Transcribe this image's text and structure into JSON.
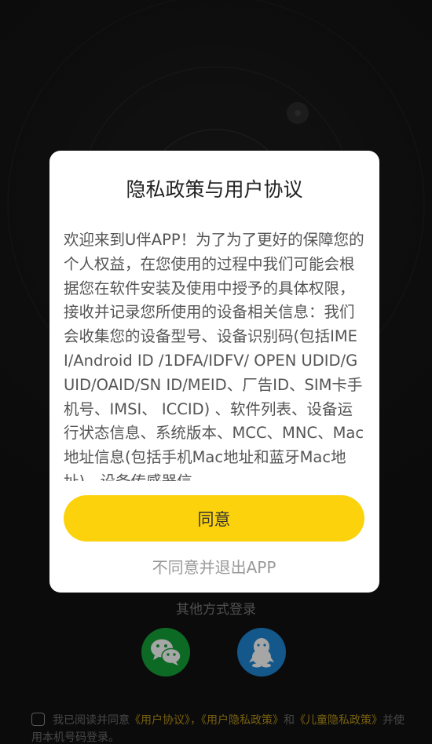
{
  "dialog": {
    "title": "隐私政策与用户协议",
    "body": "欢迎来到U伴APP！为了为了更好的保障您的个人权益，在您使用的过程中我们可能会根据您在软件安装及使用中授予的具体权限，接收并记录您所使用的设备相关信息：我们会收集您的设备型号、设备识别码(包括IMEI/Android ID /1DFA/IDFV/ OPEN UDID/GUID/OAID/SN ID/MEID、厂告ID、SIM卡手机号、IMSI、 ICCID) 、软件列表、设备运行状态信息、系统版本、MCC、MNC、Mac地址信息(包括手机Mac地址和蓝牙Mac地址)、设备传感器信",
    "agree_label": "同意",
    "decline_label": "不同意并退出APP"
  },
  "login": {
    "other_methods_label": "其他方式登录",
    "social": [
      {
        "name": "wechat",
        "icon": "wechat-icon",
        "color": "#15a33a"
      },
      {
        "name": "qq",
        "icon": "qq-penguin-icon",
        "color": "#1f88d6"
      }
    ]
  },
  "consent": {
    "prefix": "我已阅读并同意",
    "user_agreement": "《用户协议》",
    "sep1": "，",
    "privacy_policy": "《用户隐私政策》",
    "and": "和",
    "children_policy": "《儿童隐私政策》",
    "suffix": "并使用本机号码登录。"
  },
  "colors": {
    "accent": "#fbd20c",
    "link": "#b89418",
    "background": "#121212"
  }
}
